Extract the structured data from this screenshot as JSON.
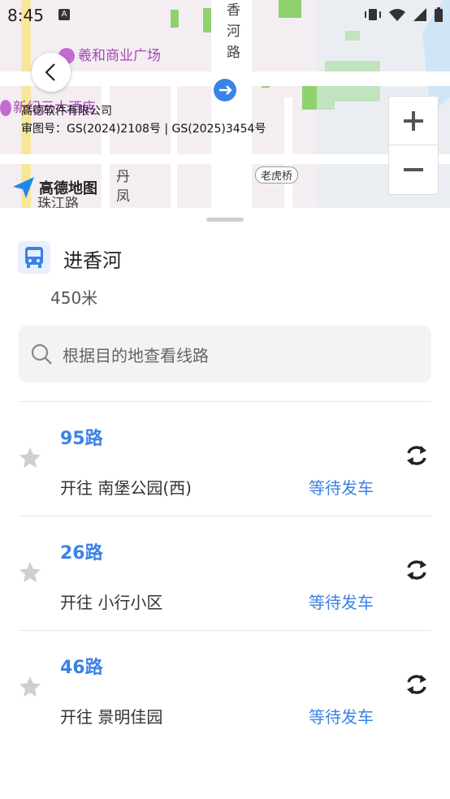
{
  "status_bar": {
    "time": "8:45",
    "notif_icon": "A"
  },
  "map": {
    "labels": {
      "street_vertical": "香\n河\n路",
      "poi_plaza": "羲和商业广场",
      "poi_hotel": "新纪元大酒店",
      "road_tag": "老虎桥",
      "dan_feng": "丹\n凤",
      "zhujiang": "珠江路"
    },
    "attribution": {
      "company": "高德软件有限公司",
      "license": "审图号：GS(2024)2108号 | GS(2025)3454号"
    },
    "logo_text": "高德地图"
  },
  "stop": {
    "name": "进香河",
    "distance": "450米"
  },
  "search": {
    "placeholder": "根据目的地查看线路"
  },
  "routes": [
    {
      "name": "95路",
      "direction": "开往 南堡公园(西)",
      "status": "等待发车"
    },
    {
      "name": "26路",
      "direction": "开往 小行小区",
      "status": "等待发车"
    },
    {
      "name": "46路",
      "direction": "开往 景明佳园",
      "status": "等待发车"
    }
  ],
  "colors": {
    "accent": "#3b82e6",
    "poi": "#a44bb3",
    "green_area": "#8fd16f"
  }
}
